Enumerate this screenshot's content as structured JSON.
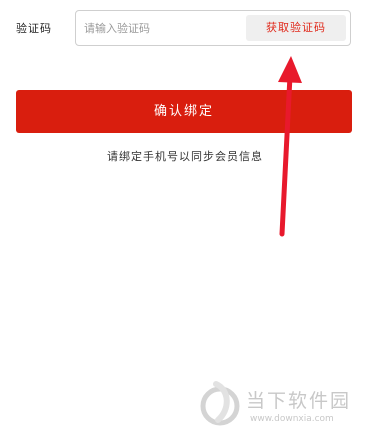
{
  "form": {
    "code_label": "验证码",
    "code_placeholder": "请输入验证码",
    "code_value": "",
    "get_code_label": "获取验证码"
  },
  "actions": {
    "confirm_label": "确认绑定"
  },
  "hint": "请绑定手机号以同步会员信息",
  "watermark": {
    "name": "当下软件园",
    "url": "www.downxia.com"
  },
  "colors": {
    "primary_red": "#d91e0e",
    "get_code_text": "#e0281a",
    "annotation_arrow": "#e8192c"
  },
  "icons": {
    "annotation": "red-arrow-icon",
    "watermark_logo": "downxia-logo-icon"
  }
}
